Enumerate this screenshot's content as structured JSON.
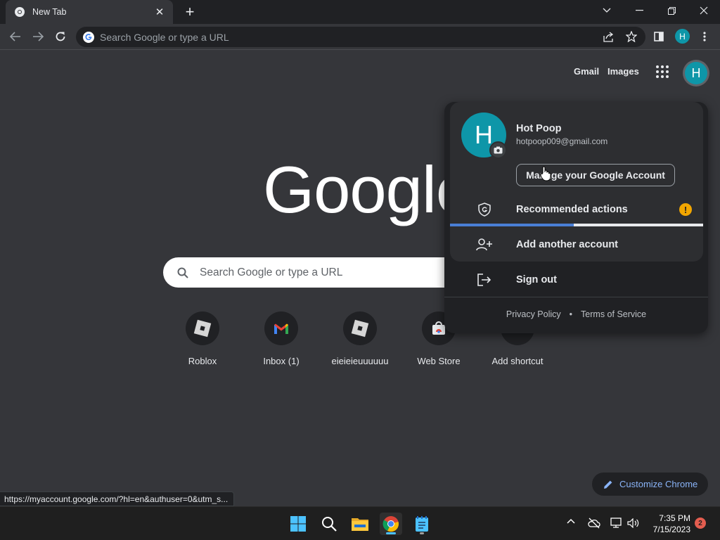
{
  "browser": {
    "tab_title": "New Tab",
    "omnibox_placeholder": "Search Google or type a URL",
    "profile_initial": "H"
  },
  "ntp": {
    "gmail_link": "Gmail",
    "images_link": "Images",
    "avatar_initial": "H",
    "logo_text": "Google",
    "search_placeholder": "Search Google or type a URL",
    "shortcuts": [
      {
        "label": "Roblox",
        "icon": "roblox-icon"
      },
      {
        "label": "Inbox (1)",
        "icon": "gmail-icon"
      },
      {
        "label": "eieieieuuuuuu",
        "icon": "roblox-icon"
      },
      {
        "label": "Web Store",
        "icon": "web-store-icon"
      },
      {
        "label": "Add shortcut",
        "icon": "plus-icon"
      }
    ],
    "customize_label": "Customize Chrome"
  },
  "account_popup": {
    "avatar_initial": "H",
    "name": "Hot Poop",
    "email": "hotpoop009@gmail.com",
    "manage_label": "Manage your Google Account",
    "recommended_label": "Recommended actions",
    "recommended_badge": "!",
    "progress_fraction": 0.49,
    "add_account_label": "Add another account",
    "sign_out_label": "Sign out",
    "privacy_label": "Privacy Policy",
    "footer_separator": "•",
    "terms_label": "Terms of Service"
  },
  "status_url": "https://myaccount.google.com/?hl=en&authuser=0&utm_s...",
  "taskbar": {
    "time": "7:35 PM",
    "date": "7/15/2023",
    "notification_count": "2"
  },
  "colors": {
    "accent": "#8ab4f8",
    "avatar": "#0e96a8",
    "warning": "#f2a600",
    "progress": "#4a7fd6"
  }
}
